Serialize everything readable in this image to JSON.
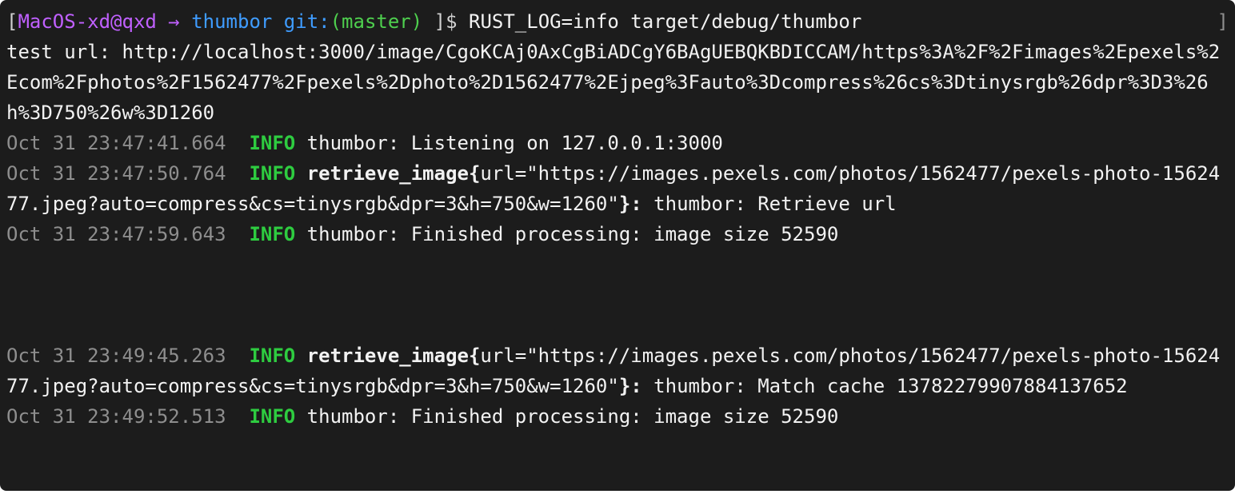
{
  "prompt": {
    "open_bracket": "[",
    "host": "MacOS-xd@qxd",
    "arrow": " → ",
    "dir": "thumbor",
    "gitlbl": " git:",
    "branch": "(master)",
    "suffix": " ]$ ",
    "command": "RUST_LOG=info target/debug/thumbor",
    "right_bracket": "]"
  },
  "test_url_line": "test url: http://localhost:3000/image/CgoKCAj0AxCgBiADCgY6BAgUEBQKBDICCAM/https%3A%2F%2Fimages%2Epexels%2Ecom%2Fphotos%2F1562477%2Fpexels%2Dphoto%2D1562477%2Ejpeg%3Fauto%3Dcompress%26cs%3Dtinysrgb%26dpr%3D3%26h%3D750%26w%3D1260",
  "log": {
    "l1": {
      "ts": "Oct 31 23:47:41.664  ",
      "lvl": "INFO",
      "msg": " thumbor: Listening on 127.0.0.1:3000"
    },
    "l2": {
      "ts": "Oct 31 23:47:50.764  ",
      "lvl": "INFO",
      "span": " retrieve_image{",
      "args": "url=\"https://images.pexels.com/photos/1562477/pexels-photo-1562477.jpeg?auto=compress&cs=tinysrgb&dpr=3&h=750&w=1260\"",
      "close": "}:",
      "msg": " thumbor: Retrieve url"
    },
    "l3": {
      "ts": "Oct 31 23:47:59.643  ",
      "lvl": "INFO",
      "msg": " thumbor: Finished processing: image size 52590"
    },
    "l4": {
      "ts": "Oct 31 23:49:45.263  ",
      "lvl": "INFO",
      "span": " retrieve_image{",
      "args": "url=\"https://images.pexels.com/photos/1562477/pexels-photo-1562477.jpeg?auto=compress&cs=tinysrgb&dpr=3&h=750&w=1260\"",
      "close": "}:",
      "msg": " thumbor: Match cache 13782279907884137652"
    },
    "l5": {
      "ts": "Oct 31 23:49:52.513  ",
      "lvl": "INFO",
      "msg": " thumbor: Finished processing: image size 52590"
    }
  }
}
